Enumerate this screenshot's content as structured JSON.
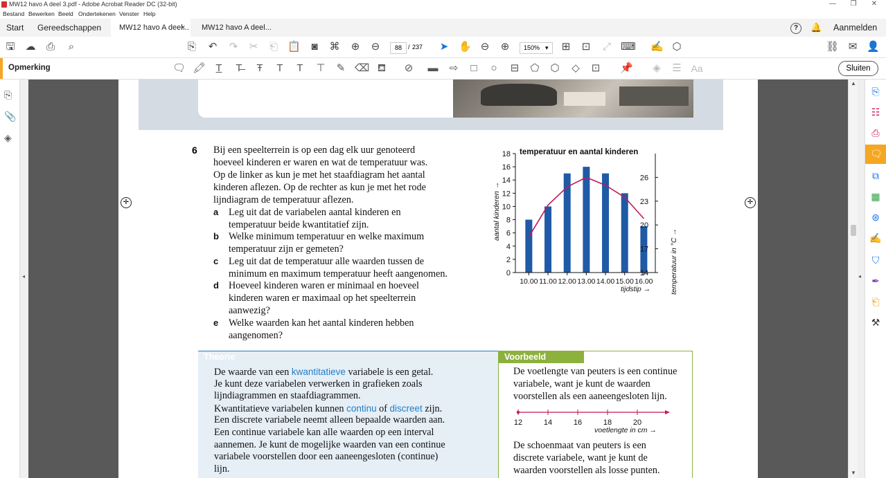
{
  "window": {
    "title": "MW12 havo A deel 3.pdf - Adobe Acrobat Reader DC (32-bit)",
    "minimize": "—",
    "restore": "❐",
    "close": "✕"
  },
  "menu": [
    "Bestand",
    "Bewerken",
    "Beeld",
    "Ondertekenen",
    "Venster",
    "Help"
  ],
  "tabs": {
    "start": "Start",
    "tools": "Gereedschappen",
    "doc1": "MW12 havo A deel...",
    "doc1_close": "×",
    "doc2": "MW12 havo A deel...",
    "help_icon": "?",
    "signin": "Aanmelden"
  },
  "toolbar": {
    "page_current": "88",
    "page_sep": "/",
    "page_total": "237",
    "zoom": "150%",
    "zoom_caret": "▾"
  },
  "commentbar": {
    "label": "Opmerking",
    "close": "Sluiten",
    "text_icon_label": "Aa"
  },
  "exercise": {
    "number": "6",
    "intro": [
      "Bij een speelterrein is op een dag elk uur genoteerd",
      "hoeveel kinderen er waren en wat de temperatuur was.",
      "Op de linker as kun je met het staafdiagram het aantal",
      "kinderen aflezen. Op de rechter as kun je met het rode",
      "lijndiagram de temperatuur aflezen."
    ],
    "items": [
      {
        "label": "a",
        "lines": [
          "Leg uit dat de variabelen aantal kinderen en",
          "temperatuur beide kwantitatief zijn."
        ]
      },
      {
        "label": "b",
        "lines": [
          "Welke minimum temperatuur en welke maximum",
          "temperatuur zijn er gemeten?"
        ]
      },
      {
        "label": "c",
        "lines": [
          "Leg uit dat de temperatuur alle waarden tussen de",
          "minimum en maximum temperatuur heeft aangenomen."
        ]
      },
      {
        "label": "d",
        "lines": [
          "Hoeveel kinderen waren er minimaal en hoeveel",
          "kinderen waren er maximaal op het speelterrein",
          "aanwezig?"
        ]
      },
      {
        "label": "e",
        "lines": [
          "Welke waarden kan het aantal kinderen hebben",
          "aangenomen?"
        ]
      }
    ]
  },
  "chart_data": {
    "type": "bar",
    "title": "temperatuur en aantal kinderen",
    "xlabel": "tijdstip →",
    "ylabel": "aantal kinderen →",
    "y2label": "temperatuur in °C →",
    "categories": [
      "10.00",
      "11.00",
      "12.00",
      "13.00",
      "14.00",
      "15.00",
      "16.00"
    ],
    "series": [
      {
        "name": "aantal kinderen",
        "values": [
          8,
          10,
          15,
          16,
          15,
          12,
          7
        ],
        "color": "#1f5aa6",
        "axis": "left"
      },
      {
        "name": "temperatuur",
        "type": "line",
        "values": [
          18.5,
          22.5,
          24.8,
          26.0,
          25.0,
          23.5,
          20.8
        ],
        "color": "#c2185b",
        "axis": "right"
      }
    ],
    "ylim": [
      0,
      18
    ],
    "yticks": [
      "0",
      "2",
      "4",
      "6",
      "8",
      "10",
      "12",
      "14",
      "16",
      "18"
    ],
    "y2lim": [
      14,
      29
    ],
    "y2ticks": [
      "14",
      "17",
      "20",
      "23",
      "26"
    ],
    "grid": false
  },
  "theory": {
    "heading": "Theorie",
    "color": "#1e7fc7",
    "lines": [
      {
        "parts": [
          "De waarde van een ",
          "kwantitatieve",
          " variabele is een getal."
        ]
      },
      {
        "parts": [
          "Je kunt deze variabelen verwerken in grafieken zoals",
          "",
          ""
        ]
      },
      {
        "parts": [
          "lijndiagrammen en staafdiagrammen.",
          "",
          ""
        ]
      },
      {
        "parts": [
          "Kwantitatieve variabelen kunnen ",
          "continu",
          " of "
        ],
        "extra_blue": "discreet",
        "tail": " zijn."
      },
      {
        "parts": [
          "Een discrete variabele neemt alleen bepaalde waarden aan.",
          "",
          ""
        ]
      },
      {
        "parts": [
          "Een continue variabele kan alle waarden op een interval",
          "",
          ""
        ]
      },
      {
        "parts": [
          "aannemen. Je kunt de mogelijke waarden van een continue",
          "",
          ""
        ]
      },
      {
        "parts": [
          "variabele voorstellen door een aaneengesloten (continue)",
          "",
          ""
        ]
      },
      {
        "parts": [
          "lijn.",
          "",
          ""
        ]
      }
    ]
  },
  "example": {
    "heading": "Voorbeeld",
    "color": "#8cb13c",
    "para1": [
      "De voetlengte van peuters is een continue",
      "variabele, want je kunt de waarden",
      "voorstellen als een aaneengesloten lijn."
    ],
    "numberline": {
      "ticks": [
        "12",
        "14",
        "16",
        "18",
        "20"
      ],
      "label": "voetlengte in cm →",
      "color": "#c2185b"
    },
    "para2": [
      "De schoenmaat van peuters is een",
      "discrete variabele, want je kunt de",
      "waarden voorstellen als losse punten."
    ]
  }
}
